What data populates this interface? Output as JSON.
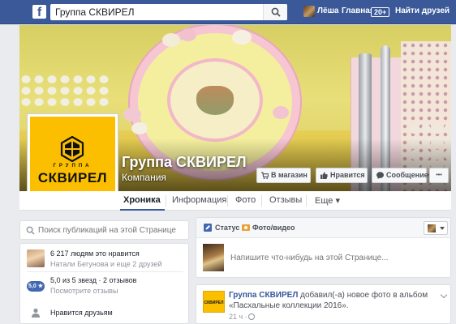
{
  "topbar": {
    "logo": "f",
    "search_value": "Группа СКВИРЕЛ",
    "user_name": "Лёша",
    "home_label": "Главная",
    "home_badge": "20+",
    "find_friends": "Найти друзей"
  },
  "page": {
    "name": "Группа СКВИРЕЛ",
    "category": "Компания",
    "logo_small": "ГРУППА",
    "logo_big": "СКВИРЕЛ"
  },
  "cover_buttons": {
    "shop": "В магазин",
    "like": "Нравится",
    "message": "Сообщение",
    "more": "•••"
  },
  "tabs": [
    "Хроника",
    "Информация",
    "Фото",
    "Отзывы",
    "Еще ▾"
  ],
  "left": {
    "search_placeholder": "Поиск публикаций на этой Странице",
    "likes_count": "6 217 людям это нравится",
    "likes_friends": "Натали Бегунова и еще 2 друзей",
    "rating_badge": "5,0 ★",
    "rating_text": "5,0 из 5 звезд · 2 отзывов",
    "rating_link": "Посмотрите отзывы",
    "friends_like": "Нравится друзьям"
  },
  "composer": {
    "status_tab": "Статус",
    "photo_tab": "Фото/видео",
    "placeholder": "Напишите что-нибудь на этой Странице..."
  },
  "post": {
    "logo_text": "СКВИРЕЛ",
    "author": "Группа СКВИРЕЛ",
    "action": " добавил(-а) новое фото в альбом",
    "album": "«Пасхальные коллекции 2016».",
    "time": "21 ч ·"
  },
  "colors": {
    "facebook_blue": "#3b5998",
    "brand_yellow": "#fbbf00",
    "link_blue": "#365899"
  },
  "icons": {
    "search": "magnifier",
    "friends": "person",
    "shop": "cart",
    "like": "thumbs-up",
    "message": "chat-bubble"
  }
}
